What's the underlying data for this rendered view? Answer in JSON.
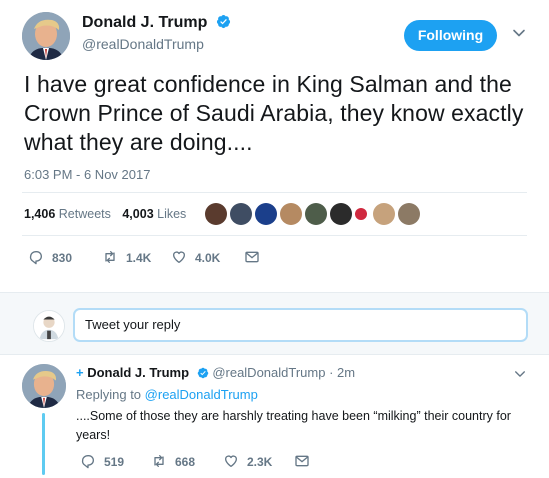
{
  "main_tweet": {
    "author_name": "Donald J. Trump",
    "author_handle": "@realDonaldTrump",
    "follow_button": "Following",
    "text": "I have great confidence in King Salman and the Crown Prince of Saudi Arabia, they know exactly what they are doing....",
    "timestamp": "6:03 PM - 6 Nov 2017",
    "retweets_count": "1,406",
    "retweets_label": "Retweets",
    "likes_count": "4,003",
    "likes_label": "Likes",
    "actions": {
      "replies": "830",
      "retweets": "1.4K",
      "likes": "4.0K"
    }
  },
  "reply_box": {
    "placeholder": "Tweet your reply"
  },
  "thread_tweet": {
    "plus": "+",
    "author_name": "Donald J. Trump",
    "author_handle": "@realDonaldTrump",
    "time": "· 2m",
    "replying_prefix": "Replying to",
    "replying_to": "@realDonaldTrump",
    "text": "....Some of those they are harshly treating have been “milking” their country for years!",
    "actions": {
      "replies": "519",
      "retweets": "668",
      "likes": "2.3K"
    }
  },
  "icons": {
    "verified": "verified-badge-icon",
    "caret": "chevron-down-icon",
    "reply": "reply-icon",
    "retweet": "retweet-icon",
    "like": "heart-icon",
    "message": "envelope-icon"
  },
  "colors": {
    "accent": "#1da1f2",
    "text": "#14171a",
    "muted": "#657786",
    "thread_line": "#5ecbf1"
  }
}
